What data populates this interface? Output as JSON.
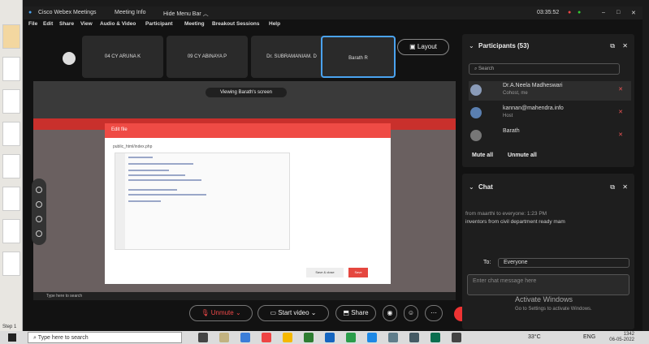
{
  "window": {
    "title": "Cisco Webex Meetings",
    "meeting_info": "Meeting Info",
    "hide_menu": "Hide Menu Bar ︿",
    "time": "03:35:52"
  },
  "menu": [
    "File",
    "Edit",
    "Share",
    "View",
    "Audio & Video",
    "Participant",
    "Meeting",
    "Breakout Sessions",
    "Help"
  ],
  "video_tiles": [
    "04 CY ARUNA K",
    "09 CY ABINAYA P",
    "Dr. SUBRAMANIAM. D",
    "Barath R"
  ],
  "layout_label": "Layout",
  "share": {
    "viewing": "Viewing Barath's screen",
    "modal_title": "Edit file",
    "modal_path": "public_html/index.php",
    "btn_cancel": "Save & close",
    "btn_save": "Save",
    "search_taskbar": "Type here to search"
  },
  "participants": {
    "title": "Participants (53)",
    "search_placeholder": "Search",
    "items": [
      {
        "name": "Dr.A.Neela Madheswari",
        "sub": "Cohost, me"
      },
      {
        "name": "kannan@mahendra.info",
        "sub": "Host"
      },
      {
        "name": "Barath",
        "sub": ""
      }
    ],
    "mute_all": "Mute all",
    "unmute_all": "Unmute all"
  },
  "chat": {
    "title": "Chat",
    "meta": "from maarthi to everyone:  1:23 PM",
    "message": "inventors from civil department ready mam",
    "to_label": "To:",
    "to_value": "Everyone",
    "input_placeholder": "Enter chat message here"
  },
  "controls": {
    "unmute": "Unmute",
    "start_video": "Start video",
    "share": "Share"
  },
  "activate": {
    "line1": "Activate Windows",
    "line2": "Go to Settings to activate Windows."
  },
  "taskbar": {
    "search": "Type here to search",
    "weather": "33°C",
    "lang": "ENG",
    "time": "1342",
    "date": "06-05-2022"
  },
  "strip": {
    "text": "Step 1"
  },
  "colors": {
    "accent_red": "#ef4b45",
    "webex_bg": "#121212",
    "active_blue": "#4aa3f0"
  }
}
